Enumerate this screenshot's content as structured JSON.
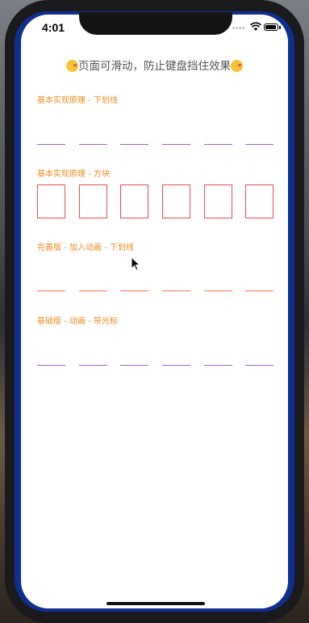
{
  "status": {
    "time": "4:01"
  },
  "title": {
    "text": "页面可滑动，防止键盘挡住效果",
    "emoji": "kissing-face-emoji"
  },
  "sections": [
    {
      "label": "基本实现原理 - 下划线",
      "style": "underline",
      "color": "#a763c4",
      "digits": 6
    },
    {
      "label": "基本实现原理 - 方块",
      "style": "box",
      "color": "#ee4d4d",
      "digits": 6
    },
    {
      "label": "完善版 - 加入动画 - 下划线",
      "style": "underline",
      "color": "#f2735b",
      "digits": 6
    },
    {
      "label": "基础版 - 动画 - 带光标",
      "style": "underline",
      "color": "#a763c4",
      "digits": 6
    }
  ],
  "colors": {
    "label": "#f08c1e",
    "frame": "#0f2f8f"
  }
}
